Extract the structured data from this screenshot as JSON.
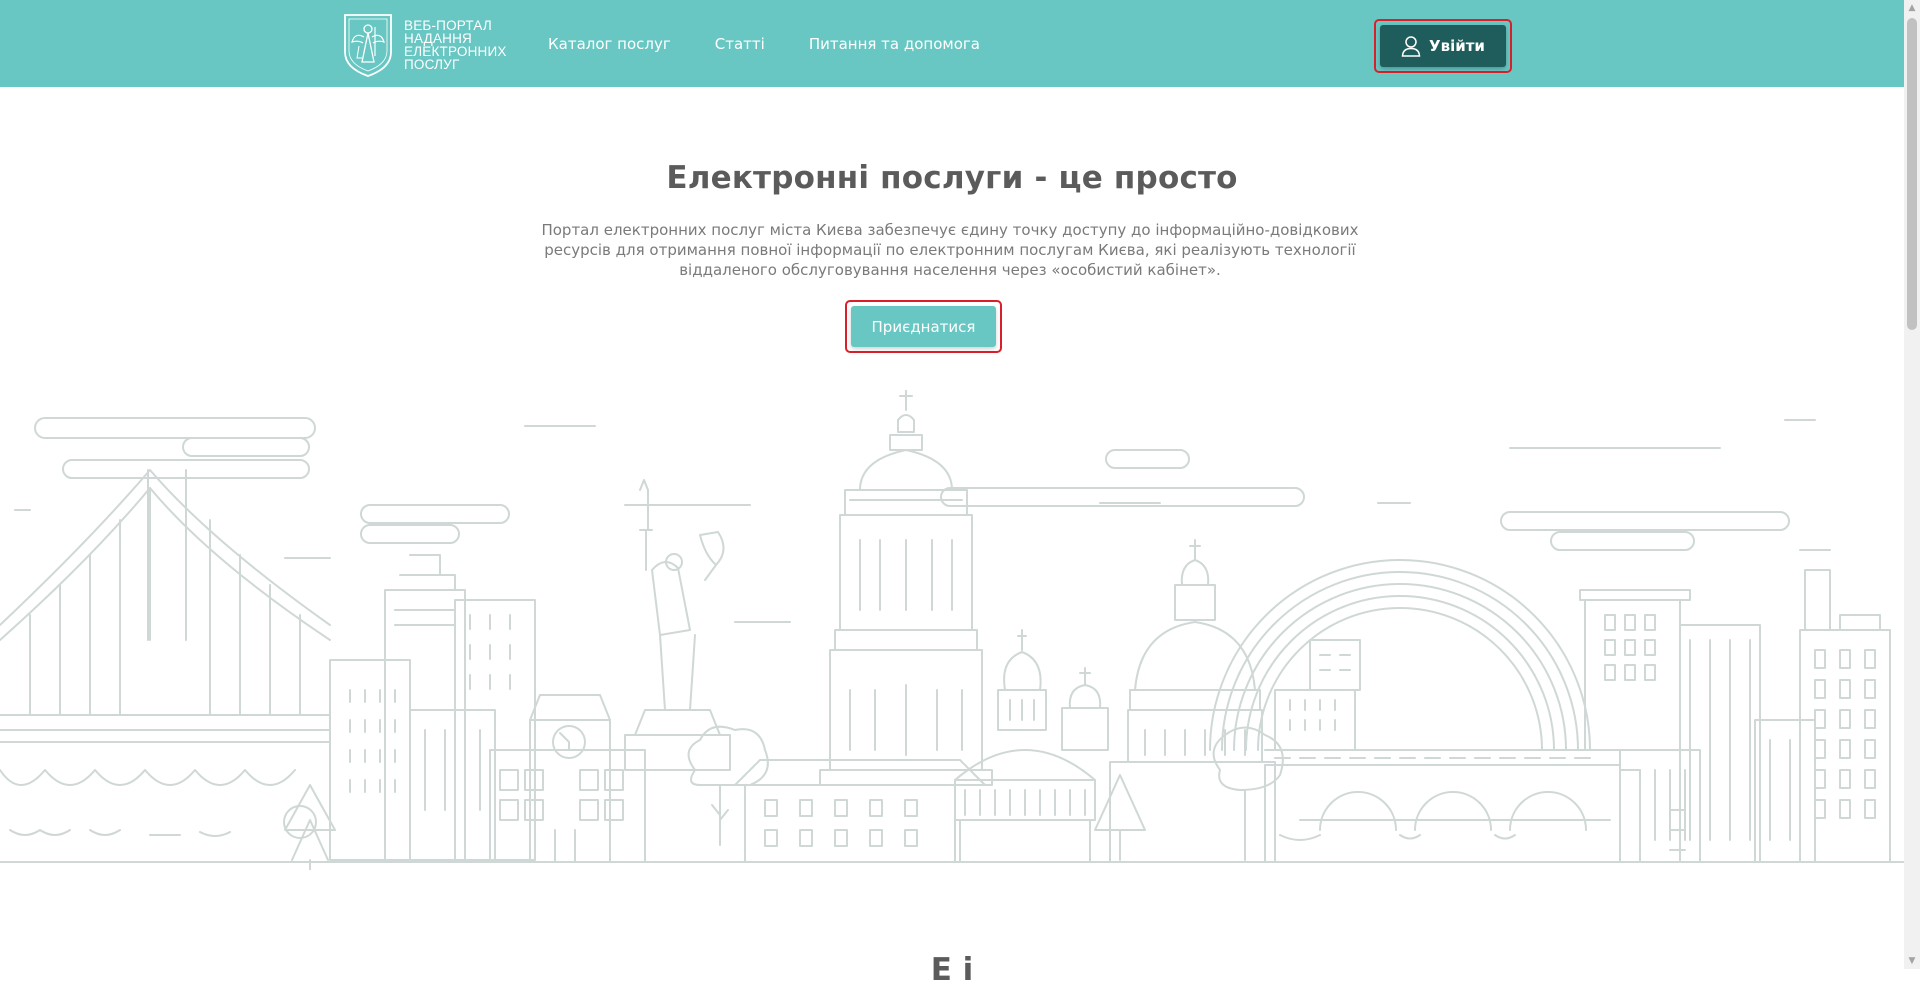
{
  "colors": {
    "brand": "#68c7c3",
    "dark": "#1f5d5c",
    "highlight": "#d9202a",
    "line": "#cfd7d7"
  },
  "header": {
    "logo_lines": [
      "ВЕБ-ПОРТАЛ",
      "НАДАННЯ",
      "ЕЛЕКТРОННИХ",
      "ПОСЛУГ"
    ],
    "nav": [
      "Каталог послуг",
      "Статті",
      "Питання та допомога"
    ],
    "login_label": "Увійти",
    "login_icon": "user-icon"
  },
  "hero": {
    "title": "Електронні послуги - це просто",
    "description": "Портал електронних послуг міста Києва забезпечує єдину точку доступу до інформаційно-довідкових ресурсів для отримання повної інформації по електронним послугам Києва, які реалізують технології віддаленого обслуговування населення через «особистий кабінет».",
    "join_label": "Приєднатися"
  },
  "section": {
    "title_partial": "Е                    і"
  },
  "scrollbar": {
    "up_icon": "▲",
    "down_icon": "▼"
  }
}
